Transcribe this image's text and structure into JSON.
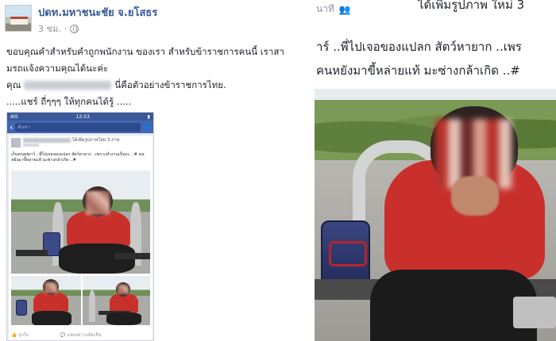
{
  "post": {
    "page_name": "ปดท.มหาชนะชัย จ.ยโสธร",
    "time": "3 ชม.",
    "text_line1": "ขอบคุณคำสำหรับคำถูกพนักงาน ของเรา สำหรับข้าราชการคนนี้ เราสา",
    "text_line2": "มรถแจ้งความคุณได้นะค่ะ",
    "text_line3_prefix": "คุณ",
    "text_line3_suffix": "นี่คือตัวอย่างข้าราชการไทย.",
    "share_text": ".....แชร์ ถี่ๆๆๆ ให้ทุกคนได้รู้ ....."
  },
  "phone": {
    "carrier": "AIS",
    "clock": "12:53",
    "search_placeholder": "ค้นหา",
    "action_text": "ได้เพิ่มรูปภาพใหม่ 3 ภาพ",
    "post_text": "เก็บตกสุปตาร์ ..พี่ไปเจอของแปลก สัตว์หายาก ..เพราะทำงานเป็นกะ ..# คนหยังมาขี้หล่ายแท้ มะซ่างกล้าเกิด ..#",
    "like_label": "ถูกใจ",
    "comment_label": "แสดงความคิดเห็น"
  },
  "right": {
    "time_fragment": "นาที",
    "title_fragment": "ได้เพิ่มรูปภาพ ใหม่ 3",
    "text_line1": "าร์ ..พี่ไปเจอของแปลก สัตว์หายาก ..เพร",
    "text_line2": "คนหยังมาขี้หล่ายแท้ มะซ่างกล้าเกิด ..#"
  },
  "colors": {
    "link_blue": "#365899",
    "fb_blue": "#4267b2",
    "meta_gray": "#90949c"
  }
}
